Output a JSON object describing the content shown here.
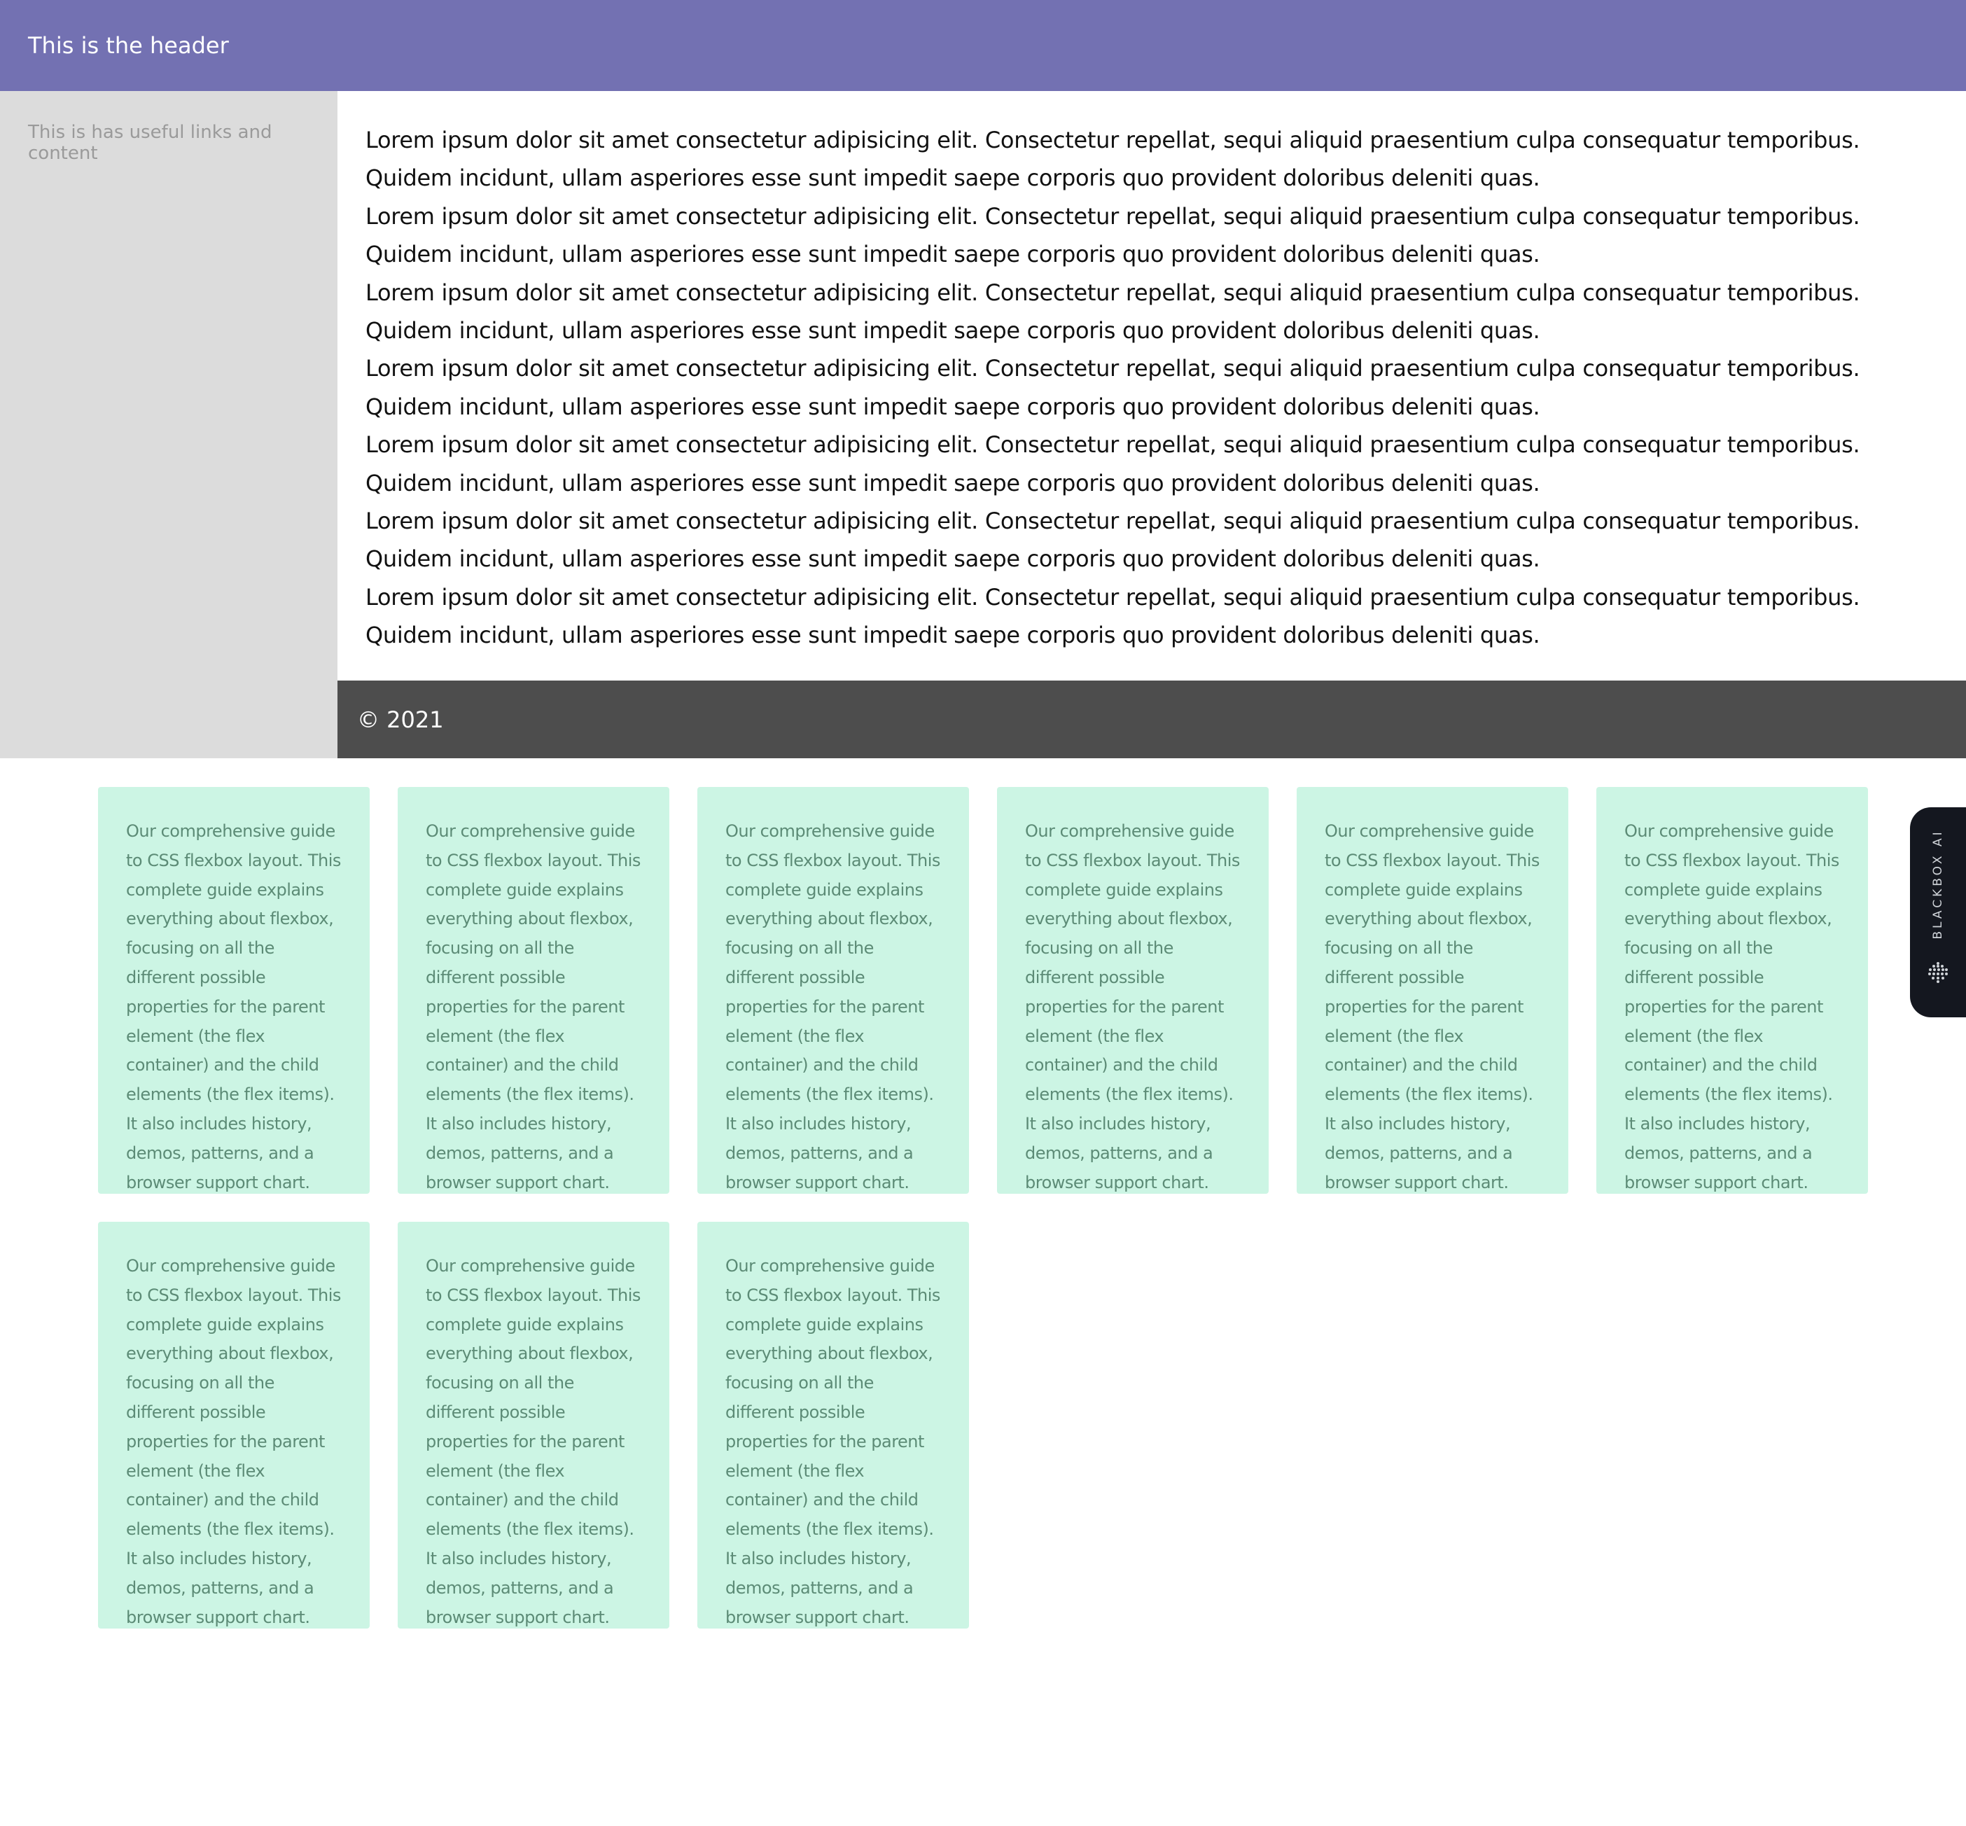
{
  "header": {
    "title": "This is the header"
  },
  "sidebar": {
    "text": "This is has useful links and content"
  },
  "main": {
    "paragraphs": [
      "Lorem ipsum dolor sit amet consectetur adipisicing elit. Consectetur repellat, sequi aliquid praesentium culpa consequatur temporibus. Quidem incidunt, ullam asperiores esse sunt impedit saepe corporis quo provident doloribus deleniti quas.",
      "Lorem ipsum dolor sit amet consectetur adipisicing elit. Consectetur repellat, sequi aliquid praesentium culpa consequatur temporibus. Quidem incidunt, ullam asperiores esse sunt impedit saepe corporis quo provident doloribus deleniti quas.",
      "Lorem ipsum dolor sit amet consectetur adipisicing elit. Consectetur repellat, sequi aliquid praesentium culpa consequatur temporibus. Quidem incidunt, ullam asperiores esse sunt impedit saepe corporis quo provident doloribus deleniti quas.",
      "Lorem ipsum dolor sit amet consectetur adipisicing elit. Consectetur repellat, sequi aliquid praesentium culpa consequatur temporibus. Quidem incidunt, ullam asperiores esse sunt impedit saepe corporis quo provident doloribus deleniti quas.",
      "Lorem ipsum dolor sit amet consectetur adipisicing elit. Consectetur repellat, sequi aliquid praesentium culpa consequatur temporibus. Quidem incidunt, ullam asperiores esse sunt impedit saepe corporis quo provident doloribus deleniti quas.",
      "Lorem ipsum dolor sit amet consectetur adipisicing elit. Consectetur repellat, sequi aliquid praesentium culpa consequatur temporibus. Quidem incidunt, ullam asperiores esse sunt impedit saepe corporis quo provident doloribus deleniti quas.",
      "Lorem ipsum dolor sit amet consectetur adipisicing elit. Consectetur repellat, sequi aliquid praesentium culpa consequatur temporibus. Quidem incidunt, ullam asperiores esse sunt impedit saepe corporis quo provident doloribus deleniti quas."
    ]
  },
  "footer": {
    "text": "© 2021"
  },
  "cards": [
    {
      "text": "Our comprehensive guide to CSS flexbox layout. This complete guide explains everything about flexbox, focusing on all the different possible properties for the parent element (the flex container) and the child elements (the flex items). It also includes history, demos, patterns, and a browser support chart."
    },
    {
      "text": "Our comprehensive guide to CSS flexbox layout. This complete guide explains everything about flexbox, focusing on all the different possible properties for the parent element (the flex container) and the child elements (the flex items). It also includes history, demos, patterns, and a browser support chart."
    },
    {
      "text": "Our comprehensive guide to CSS flexbox layout. This complete guide explains everything about flexbox, focusing on all the different possible properties for the parent element (the flex container) and the child elements (the flex items). It also includes history, demos, patterns, and a browser support chart."
    },
    {
      "text": "Our comprehensive guide to CSS flexbox layout. This complete guide explains everything about flexbox, focusing on all the different possible properties for the parent element (the flex container) and the child elements (the flex items). It also includes history, demos, patterns, and a browser support chart."
    },
    {
      "text": "Our comprehensive guide to CSS flexbox layout. This complete guide explains everything about flexbox, focusing on all the different possible properties for the parent element (the flex container) and the child elements (the flex items). It also includes history, demos, patterns, and a browser support chart."
    },
    {
      "text": "Our comprehensive guide to CSS flexbox layout. This complete guide explains everything about flexbox, focusing on all the different possible properties for the parent element (the flex container) and the child elements (the flex items). It also includes history, demos, patterns, and a browser support chart."
    },
    {
      "text": "Our comprehensive guide to CSS flexbox layout. This complete guide explains everything about flexbox, focusing on all the different possible properties for the parent element (the flex container) and the child elements (the flex items). It also includes history, demos, patterns, and a browser support chart."
    },
    {
      "text": "Our comprehensive guide to CSS flexbox layout. This complete guide explains everything about flexbox, focusing on all the different possible properties for the parent element (the flex container) and the child elements (the flex items). It also includes history, demos, patterns, and a browser support chart."
    },
    {
      "text": "Our comprehensive guide to CSS flexbox layout. This complete guide explains everything about flexbox, focusing on all the different possible properties for the parent element (the flex container) and the child elements (the flex items). It also includes history, demos, patterns, and a browser support chart."
    }
  ],
  "blackbox_tab": {
    "label": "BLACKBOX AI",
    "icon": "blackbox-logo-icon"
  },
  "colors": {
    "header_bg": "#7371b2",
    "sidebar_bg": "#dcdcdc",
    "footer_bg": "#4d4d4d",
    "card_bg": "#ccf5e4",
    "card_text": "#5c8b76",
    "tab_bg": "#14171f"
  }
}
